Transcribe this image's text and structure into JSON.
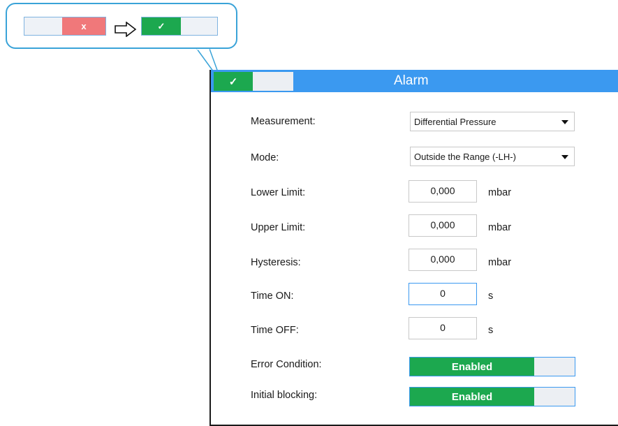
{
  "callout": {
    "before_toggle": {
      "off_mark": "x",
      "off_color": "#f0787a"
    },
    "after_toggle": {
      "on_mark": "✓",
      "on_color": "#1ca84f"
    },
    "arrow_icon": "right-arrow-icon"
  },
  "dialog": {
    "title": "Alarm",
    "title_toggle_mark": "✓",
    "accent_color": "#3b99f0",
    "fields": {
      "measurement": {
        "label": "Measurement:",
        "value": "Differential Pressure"
      },
      "mode": {
        "label": "Mode:",
        "value": "Outside the Range (-LH-)"
      },
      "lower_limit": {
        "label": "Lower Limit:",
        "value": "0,000",
        "unit": "mbar"
      },
      "upper_limit": {
        "label": "Upper Limit:",
        "value": "0,000",
        "unit": "mbar"
      },
      "hysteresis": {
        "label": "Hysteresis:",
        "value": "0,000",
        "unit": "mbar"
      },
      "time_on": {
        "label": "Time ON:",
        "value": "0",
        "unit": "s"
      },
      "time_off": {
        "label": "Time OFF:",
        "value": "0",
        "unit": "s"
      },
      "error_condition": {
        "label": "Error Condition:",
        "value": "Enabled"
      },
      "initial_blocking": {
        "label": "Initial blocking:",
        "value": "Enabled"
      }
    }
  }
}
